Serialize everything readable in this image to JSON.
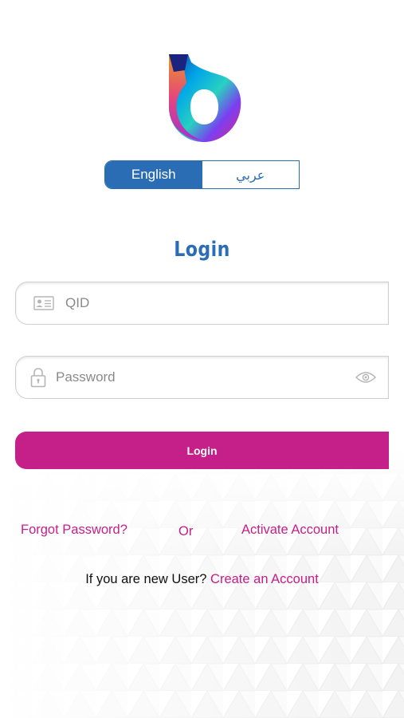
{
  "language_toggle": {
    "english": "English",
    "arabic": "عربي",
    "selected": "English"
  },
  "title": "Login",
  "qid_field": {
    "placeholder": "QID",
    "value": "",
    "icon": "id-card-icon"
  },
  "password_field": {
    "placeholder": "Password",
    "value": "",
    "icon": "lock-icon",
    "toggle_icon": "eye-icon"
  },
  "login_button": "Login",
  "links": {
    "forgot_password": "Forgot Password?",
    "or": "Or",
    "activate_account": "Activate Account"
  },
  "new_user": {
    "prompt": "If you are new User?",
    "create_account": "Create an Account"
  },
  "colors": {
    "primary_blue": "#2a6db5",
    "brand_magenta": "#c51f8a",
    "field_border": "#cfcfcf"
  }
}
